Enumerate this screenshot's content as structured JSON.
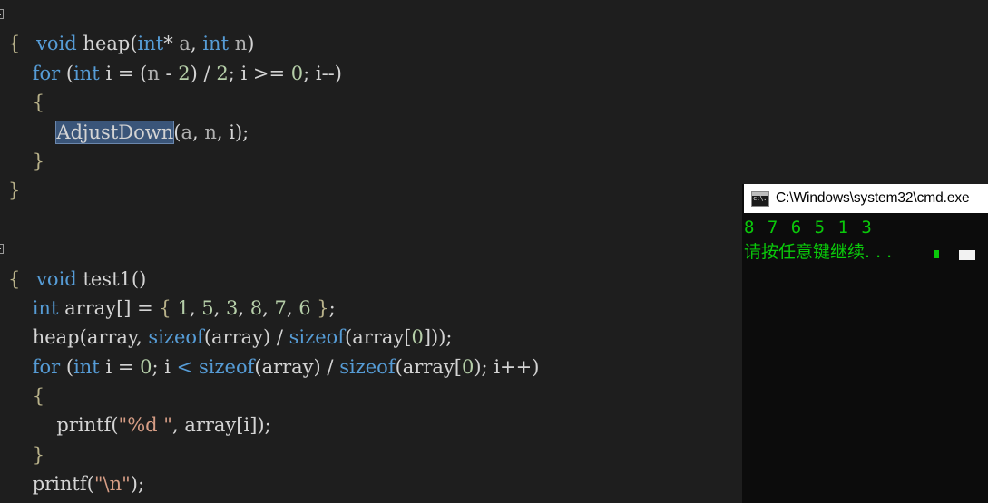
{
  "editor": {
    "name": "code-editor",
    "background": "#1e1e1e",
    "colors": {
      "keyword": "#569cd6",
      "number": "#b5cea8",
      "string": "#d69d85",
      "identifier": "#d4d4d4",
      "selection_bg": "#3a5579",
      "selection_border": "#6b87ad"
    },
    "selected_text": "AdjustDown",
    "lines": [
      {
        "id": "line-1",
        "text": "void heap(int* a, int n)"
      },
      {
        "id": "line-2",
        "text": "{"
      },
      {
        "id": "line-3",
        "text": "    for (int i = (n - 2) / 2; i >= 0; i--)"
      },
      {
        "id": "line-4",
        "text": "    {"
      },
      {
        "id": "line-5",
        "text": "        AdjustDown(a, n, i);"
      },
      {
        "id": "line-6",
        "text": "    }"
      },
      {
        "id": "line-7",
        "text": "}"
      },
      {
        "id": "line-8",
        "text": ""
      },
      {
        "id": "line-9",
        "text": "void test1()"
      },
      {
        "id": "line-10",
        "text": "{"
      },
      {
        "id": "line-11",
        "text": "    int array[] = { 1, 5, 3, 8, 7, 6 };"
      },
      {
        "id": "line-12",
        "text": "    heap(array, sizeof(array) / sizeof(array[0]));"
      },
      {
        "id": "line-13",
        "text": "    for (int i = 0; i < sizeof(array) / sizeof(array[0]); i++)"
      },
      {
        "id": "line-14",
        "text": "    {"
      },
      {
        "id": "line-15",
        "text": "        printf(\"%d \", array[i]);"
      },
      {
        "id": "line-16",
        "text": "    }"
      },
      {
        "id": "line-17",
        "text": "    printf(\"\\n\");"
      }
    ]
  },
  "console": {
    "name": "cmd-window",
    "icon": "cmd-console-icon",
    "title": "C:\\Windows\\system32\\cmd.exe",
    "background": "#0c0c0c",
    "text_color": "#0ac90a",
    "output_lines": [
      "8 7 6 5 1 3",
      "请按任意键继续. . ."
    ],
    "cursor_visible": true
  }
}
